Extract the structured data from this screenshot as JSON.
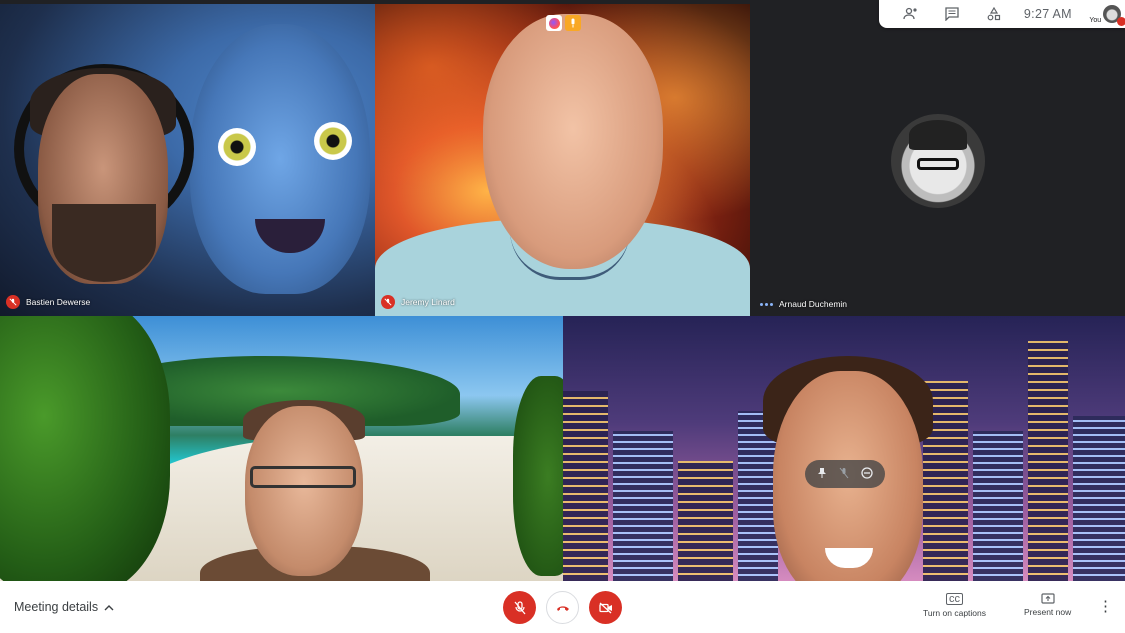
{
  "participants": [
    {
      "name": "Bastien Dewerse",
      "status": "muted",
      "icon": "mic-off-icon"
    },
    {
      "name": "Jeremy Linard",
      "status": "muted",
      "icon": "mic-off-icon"
    },
    {
      "name": "Arnaud Duchemin",
      "status": "speaking",
      "icon": "audio-dots-icon"
    }
  ],
  "topbar": {
    "icons": [
      "people-icon",
      "chat-icon",
      "activities-icon"
    ],
    "time": "9:27  AM",
    "self_label": "You"
  },
  "tile_actions": {
    "icons": [
      "pin-icon",
      "mic-icon",
      "remove-icon"
    ]
  },
  "bottombar": {
    "meeting_details_label": "Meeting details",
    "captions_label": "Turn on captions",
    "present_label": "Present now"
  },
  "colors": {
    "muted_red": "#d93025",
    "bar_bg": "#ffffff",
    "stage_bg": "#202124",
    "speaking_blue": "#8ab4f8"
  }
}
